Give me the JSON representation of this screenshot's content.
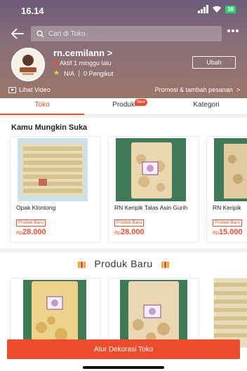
{
  "status_bar": {
    "time": "16.14",
    "battery": "38"
  },
  "search": {
    "placeholder": "Cari di Toko"
  },
  "shop": {
    "name": "rn.cemilann",
    "name_chevron": ">",
    "active_status": "Aktif 1 minggu lalu",
    "rating": "N/A",
    "followers": "0 Pengikut",
    "edit_label": "Ubah"
  },
  "links": {
    "video_label": "Lihat Video",
    "promo_label": "Promosi & tambah pesanan",
    "promo_chevron": ">"
  },
  "tabs": [
    {
      "label": "Toko",
      "active": true,
      "badge": ""
    },
    {
      "label": "Produk",
      "active": false,
      "badge": "New"
    },
    {
      "label": "Kategori",
      "active": false,
      "badge": ""
    }
  ],
  "suggest": {
    "title": "Kamu Mungkin Suka",
    "products": [
      {
        "name": "Opak Klontong",
        "badge": "Produk Baru",
        "currency": "Rp",
        "price": "28.000"
      },
      {
        "name": "RN Keripik Talas Asin Gurih",
        "badge": "Produk Baru",
        "currency": "Rp",
        "price": "28.000"
      },
      {
        "name": "RN Keripik",
        "badge": "Produk Baru",
        "currency": "Rp",
        "price": "15.000"
      }
    ]
  },
  "new_products": {
    "title": "Produk Baru"
  },
  "cta_label": "Atur Dekorasi Toko",
  "colors": {
    "accent": "#ee4d2d",
    "header_top": "#6b5b78",
    "header_bottom": "#9a7669"
  },
  "icons": [
    "back-arrow-icon",
    "search-icon",
    "more-icon",
    "video-icon",
    "star-icon",
    "chevron-right-icon"
  ]
}
